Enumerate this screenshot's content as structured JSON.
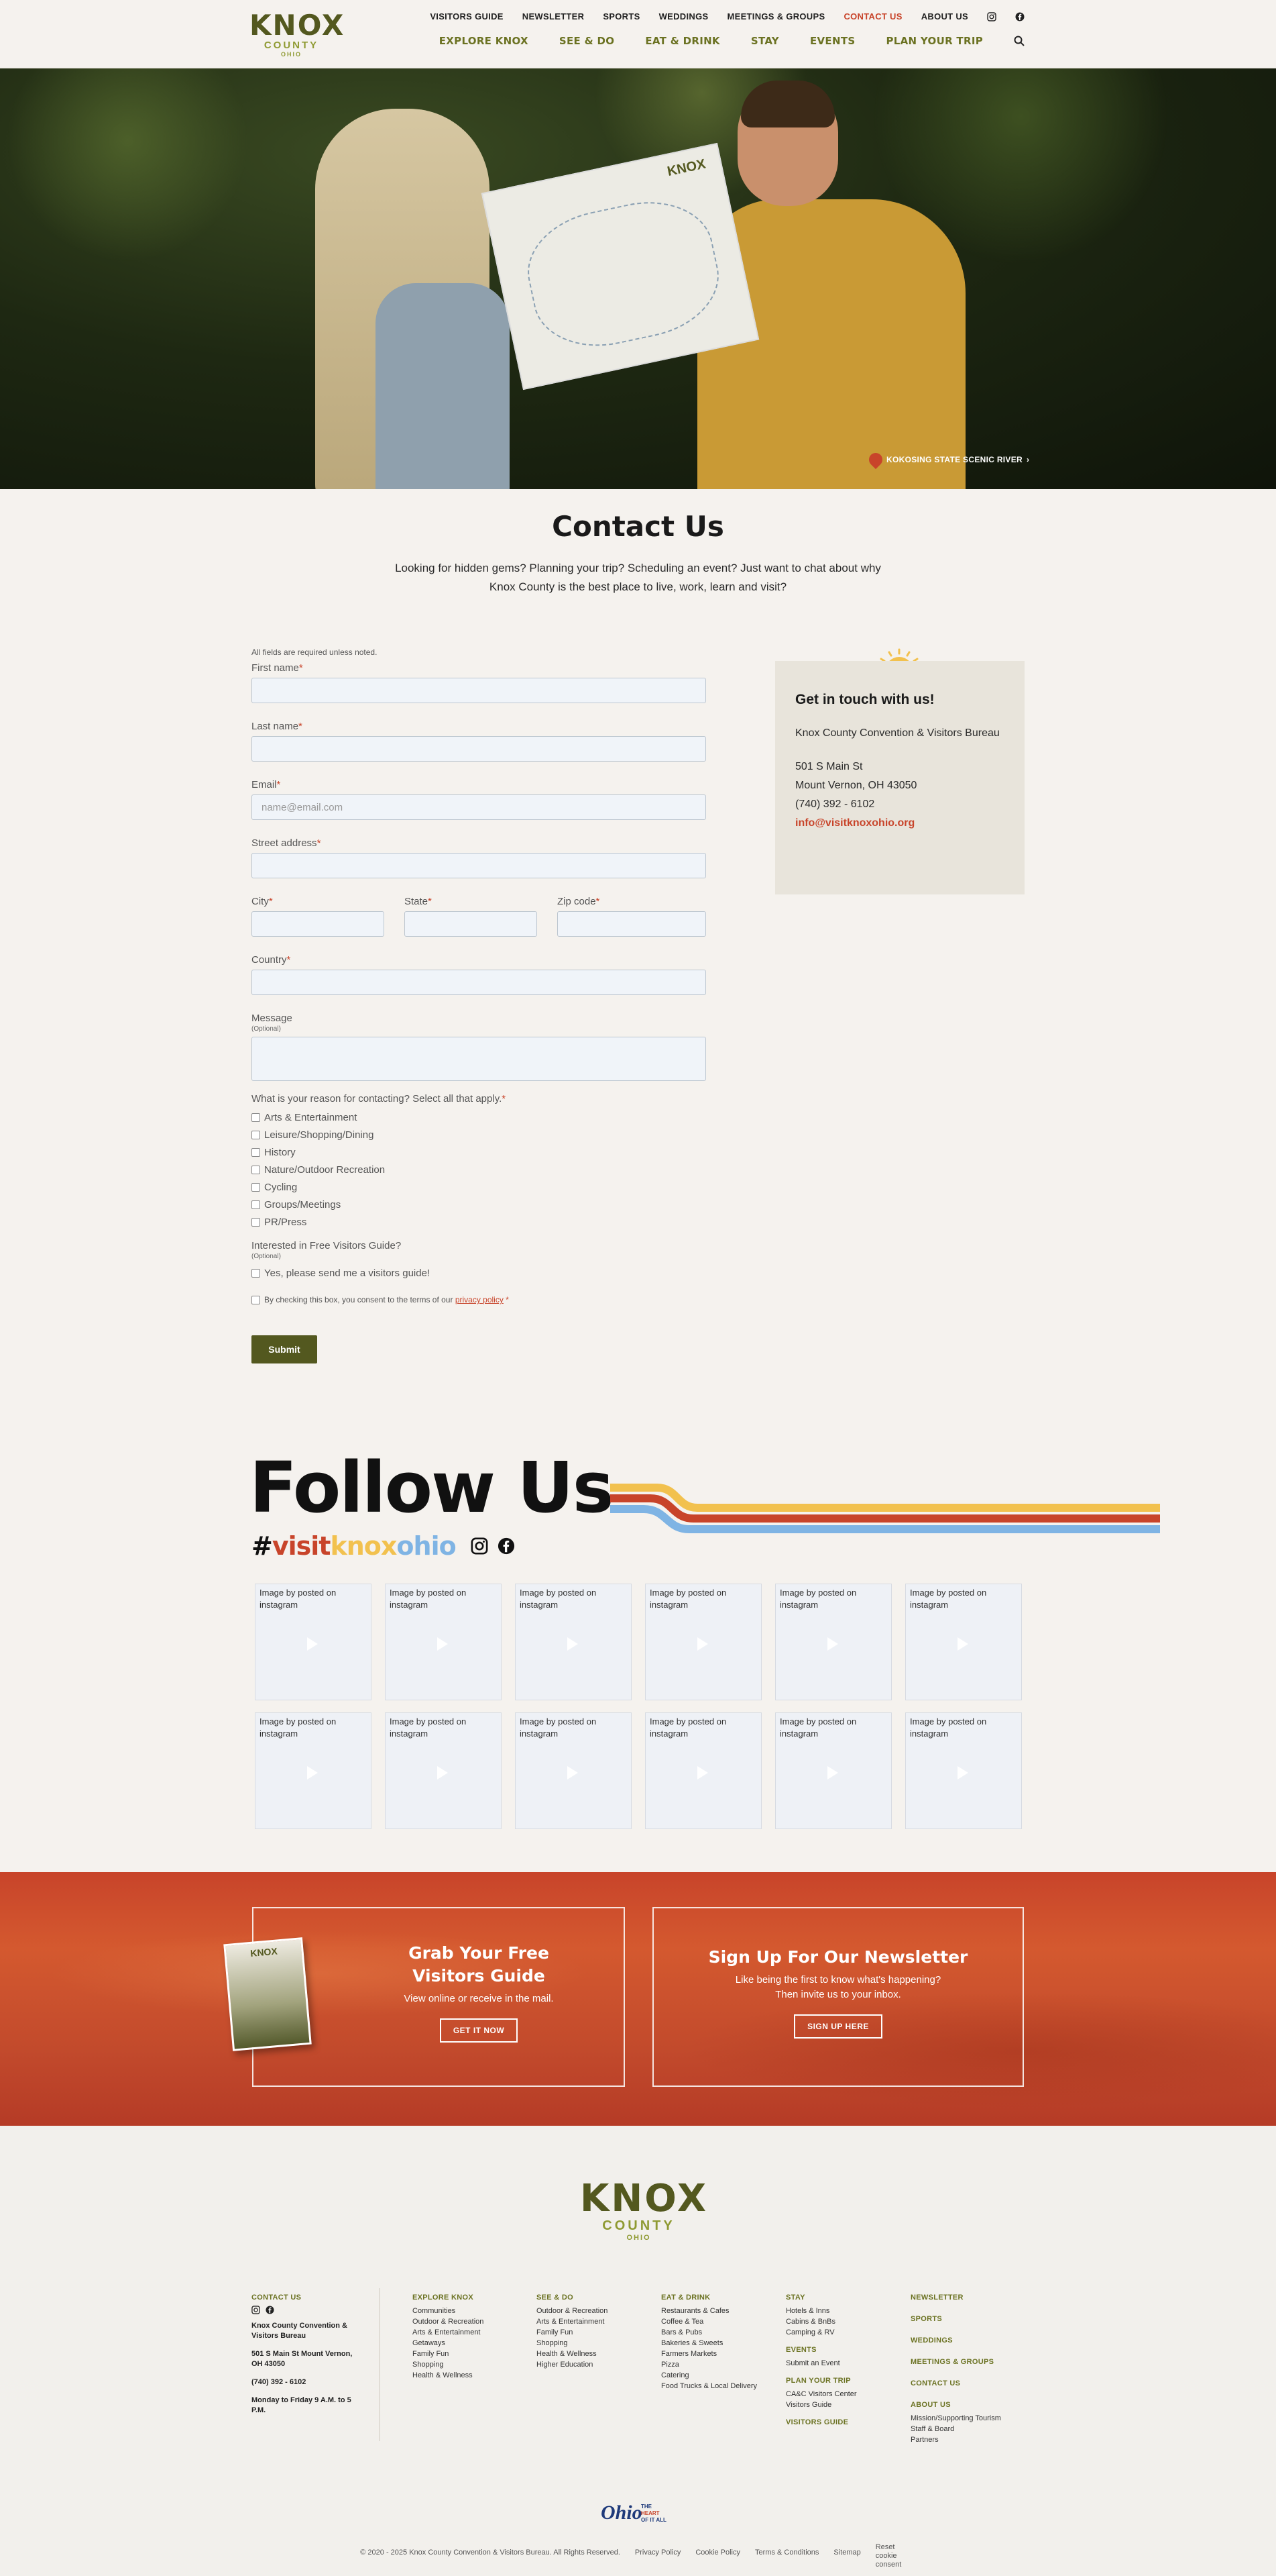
{
  "header": {
    "logo": {
      "knox": "KNOX",
      "county": "COUNTY",
      "ohio": "OHIO"
    },
    "utility_nav": [
      "VISITORS GUIDE",
      "NEWSLETTER",
      "SPORTS",
      "WEDDINGS",
      "MEETINGS & GROUPS",
      "CONTACT US",
      "ABOUT US"
    ],
    "main_nav": [
      "EXPLORE KNOX",
      "SEE & DO",
      "EAT & DRINK",
      "STAY",
      "EVENTS",
      "PLAN YOUR TRIP"
    ]
  },
  "hero": {
    "map_label": "KNOX",
    "caption": "KOKOSING STATE SCENIC RIVER"
  },
  "contact": {
    "title": "Contact Us",
    "intro": "Looking for hidden gems? Planning your trip? Scheduling an event? Just want to chat about why Knox County is the best place to live, work, learn and visit?"
  },
  "form": {
    "required_note": "All fields are required unless noted.",
    "first_name": "First name",
    "last_name": "Last name",
    "email": "Email",
    "email_placeholder": "name@email.com",
    "street": "Street address",
    "city": "City",
    "state": "State",
    "zip": "Zip code",
    "country": "Country",
    "message": "Message",
    "optional": "(Optional)",
    "reason_label": "What is your reason for contacting? Select all that apply.",
    "reasons": [
      "Arts & Entertainment",
      "Leisure/Shopping/Dining",
      "History",
      "Nature/Outdoor Recreation",
      "Cycling",
      "Groups/Meetings",
      "PR/Press"
    ],
    "guide_label": "Interested in Free Visitors Guide?",
    "guide_check": "Yes, please send me a visitors guide!",
    "consent_text": "By checking this box, you consent to the terms of our",
    "privacy_link": "privacy policy",
    "submit": "Submit"
  },
  "contact_card": {
    "heading": "Get in touch with us!",
    "org": "Knox County Convention & Visitors Bureau",
    "street": "501 S Main St",
    "city": "Mount Vernon, OH 43050",
    "phone": "(740) 392 - 6102",
    "email": "info@visitknoxohio.org"
  },
  "follow": {
    "title": "Follow Us",
    "hashtag_parts": [
      "#",
      "visit",
      "knox",
      "ohio"
    ],
    "post_text": "Image by  posted on instagram",
    "post_count": 12
  },
  "promo": {
    "guide_title": "Grab Your Free Visitors Guide",
    "guide_sub": "View online or receive in the mail.",
    "guide_btn": "GET IT NOW",
    "guide_book_title": "KNOX",
    "news_title": "Sign Up For Our Newsletter",
    "news_sub": "Like being the first to know what's happening? Then invite us to your inbox.",
    "news_btn": "SIGN UP HERE"
  },
  "footer": {
    "contact_head": "CONTACT US",
    "org": "Knox County Convention & Visitors Bureau",
    "address": "501 S Main St Mount Vernon, OH 43050",
    "phone": "(740) 392 - 6102",
    "hours": "Monday to Friday 9 A.M. to 5 P.M.",
    "explore_head": "EXPLORE KNOX",
    "explore_links": [
      "Communities",
      "Outdoor & Recreation",
      "Arts & Entertainment",
      "Getaways",
      "Family Fun",
      "Shopping",
      "Health & Wellness"
    ],
    "see_head": "SEE & DO",
    "see_links": [
      "Outdoor & Recreation",
      "Arts & Entertainment",
      "Family Fun",
      "Shopping",
      "Health & Wellness",
      "Higher Education"
    ],
    "eat_head": "EAT & DRINK",
    "eat_links": [
      "Restaurants & Cafes",
      "Coffee & Tea",
      "Bars & Pubs",
      "Bakeries & Sweets",
      "Farmers Markets",
      "Pizza",
      "Catering",
      "Food Trucks & Local Delivery"
    ],
    "stay_head": "STAY",
    "stay_links": [
      "Hotels & Inns",
      "Cabins & BnBs",
      "Camping & RV"
    ],
    "events_head": "EVENTS",
    "events_links": [
      "Submit an Event"
    ],
    "plan_head": "PLAN YOUR TRIP",
    "plan_links": [
      "CA&C Visitors Center",
      "Visitors Guide"
    ],
    "visitors_guide_head": "VISITORS GUIDE",
    "right_heads": [
      "NEWSLETTER",
      "SPORTS",
      "WEDDINGS",
      "MEETINGS & GROUPS",
      "CONTACT US",
      "ABOUT US"
    ],
    "about_links": [
      "Mission/Supporting Tourism",
      "Staff & Board",
      "Partners"
    ],
    "ohio_logo": "Ohio",
    "ohio_tagline": "THE HEART OF IT ALL",
    "copyright": "© 2020 - 2025 Knox County Convention & Visitors Bureau. All Rights Reserved.",
    "bottom_links": [
      "Privacy Policy",
      "Cookie Policy",
      "Terms & Conditions",
      "Sitemap"
    ],
    "reset_cookie": "Reset cookie consent"
  },
  "colors": {
    "olive": "#53581f",
    "accent_red": "#c8442a",
    "stripe_yellow": "#f2c14e",
    "stripe_red": "#c8442a",
    "stripe_blue": "#7fb4e4"
  }
}
